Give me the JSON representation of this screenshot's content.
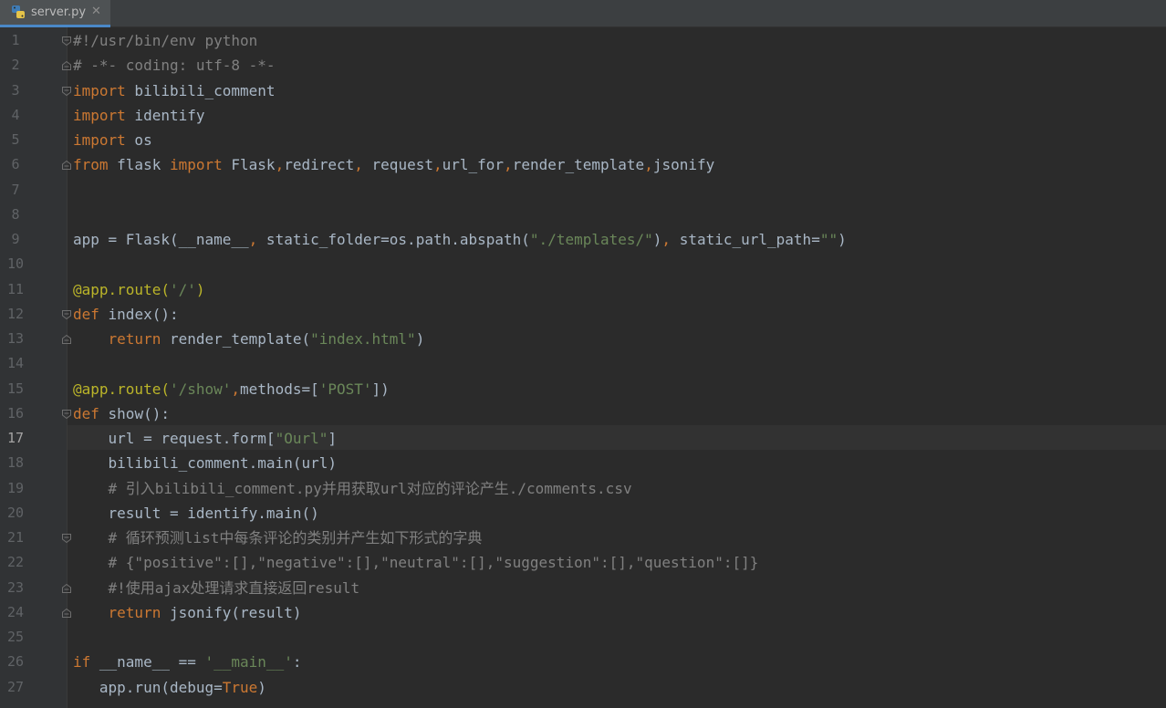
{
  "tab": {
    "filename": "server.py",
    "close_symbol": "✕"
  },
  "editor": {
    "current_line": 17,
    "line_numbers": [
      "1",
      "2",
      "3",
      "4",
      "5",
      "6",
      "7",
      "8",
      "9",
      "10",
      "11",
      "12",
      "13",
      "14",
      "15",
      "16",
      "17",
      "18",
      "19",
      "20",
      "21",
      "22",
      "23",
      "24",
      "25",
      "26",
      "27"
    ],
    "lines": [
      [
        {
          "t": "#!/usr/bin/env python",
          "c": "cmt"
        }
      ],
      [
        {
          "t": "# -*- coding: utf-8 -*-",
          "c": "cmt"
        }
      ],
      [
        {
          "t": "import",
          "c": "kw"
        },
        {
          "t": " bilibili_comment",
          "c": "cn"
        }
      ],
      [
        {
          "t": "import",
          "c": "kw"
        },
        {
          "t": " identify",
          "c": "cn"
        }
      ],
      [
        {
          "t": "import",
          "c": "kw"
        },
        {
          "t": " os",
          "c": "cn"
        }
      ],
      [
        {
          "t": "from",
          "c": "kw"
        },
        {
          "t": " flask ",
          "c": "cn"
        },
        {
          "t": "import",
          "c": "kw"
        },
        {
          "t": " Flask",
          "c": "cn"
        },
        {
          "t": ",",
          "c": "kw"
        },
        {
          "t": "redirect",
          "c": "cn"
        },
        {
          "t": ",",
          "c": "kw"
        },
        {
          "t": " request",
          "c": "cn"
        },
        {
          "t": ",",
          "c": "kw"
        },
        {
          "t": "url_for",
          "c": "cn"
        },
        {
          "t": ",",
          "c": "kw"
        },
        {
          "t": "render_template",
          "c": "cn"
        },
        {
          "t": ",",
          "c": "kw"
        },
        {
          "t": "jsonify",
          "c": "cn"
        }
      ],
      [],
      [],
      [
        {
          "t": "app = Flask(__name__",
          "c": "cn"
        },
        {
          "t": ",",
          "c": "kw"
        },
        {
          "t": " static_folder=os.path.abspath(",
          "c": "cn"
        },
        {
          "t": "\"./templates/\"",
          "c": "str"
        },
        {
          "t": ")",
          "c": "cn"
        },
        {
          "t": ",",
          "c": "kw"
        },
        {
          "t": " static_url_path=",
          "c": "cn"
        },
        {
          "t": "\"\"",
          "c": "str"
        },
        {
          "t": ")",
          "c": "cn"
        }
      ],
      [],
      [
        {
          "t": "@app.route(",
          "c": "deco"
        },
        {
          "t": "'/'",
          "c": "str"
        },
        {
          "t": ")",
          "c": "deco"
        }
      ],
      [
        {
          "t": "def",
          "c": "kw"
        },
        {
          "t": " index():",
          "c": "cn"
        }
      ],
      [
        {
          "t": "    ",
          "c": "cn"
        },
        {
          "t": "return",
          "c": "kw"
        },
        {
          "t": " render_template(",
          "c": "cn"
        },
        {
          "t": "\"index.html\"",
          "c": "str"
        },
        {
          "t": ")",
          "c": "cn"
        }
      ],
      [],
      [
        {
          "t": "@app.route(",
          "c": "deco"
        },
        {
          "t": "'/show'",
          "c": "str"
        },
        {
          "t": ",",
          "c": "kw"
        },
        {
          "t": "methods=[",
          "c": "cn"
        },
        {
          "t": "'POST'",
          "c": "str"
        },
        {
          "t": "])",
          "c": "cn"
        }
      ],
      [
        {
          "t": "def",
          "c": "kw"
        },
        {
          "t": " show():",
          "c": "cn"
        }
      ],
      [
        {
          "t": "    url = request.form[",
          "c": "cn"
        },
        {
          "t": "\"Ourl\"",
          "c": "str"
        },
        {
          "t": "]",
          "c": "cn"
        }
      ],
      [
        {
          "t": "    bilibili_comment.main(url)",
          "c": "cn"
        }
      ],
      [
        {
          "t": "    # 引入bilibili_comment.py并用获取url对应的评论产生./comments.csv",
          "c": "cmt"
        }
      ],
      [
        {
          "t": "    result = identify.main()",
          "c": "cn"
        }
      ],
      [
        {
          "t": "    # 循环预测list中每条评论的类别并产生如下形式的字典",
          "c": "cmt"
        }
      ],
      [
        {
          "t": "    # {\"positive\":[],\"negative\":[],\"neutral\":[],\"suggestion\":[],\"question\":[]}",
          "c": "cmt"
        }
      ],
      [
        {
          "t": "    #!使用ajax处理请求直接返回result",
          "c": "cmt"
        }
      ],
      [
        {
          "t": "    ",
          "c": "cn"
        },
        {
          "t": "return",
          "c": "kw"
        },
        {
          "t": " jsonify(result)",
          "c": "cn"
        }
      ],
      [],
      [
        {
          "t": "if",
          "c": "kw"
        },
        {
          "t": " __name__ == ",
          "c": "cn"
        },
        {
          "t": "'__main__'",
          "c": "str"
        },
        {
          "t": ":",
          "c": "cn"
        }
      ],
      [
        {
          "t": "   app.run(debug=",
          "c": "cn"
        },
        {
          "t": "True",
          "c": "kw"
        },
        {
          "t": ")",
          "c": "cn"
        }
      ]
    ],
    "fold_markers": [
      {
        "line": 1,
        "kind": "open"
      },
      {
        "line": 2,
        "kind": "end"
      },
      {
        "line": 3,
        "kind": "open"
      },
      {
        "line": 6,
        "kind": "end"
      },
      {
        "line": 12,
        "kind": "open"
      },
      {
        "line": 13,
        "kind": "end"
      },
      {
        "line": 16,
        "kind": "open"
      },
      {
        "line": 21,
        "kind": "open"
      },
      {
        "line": 23,
        "kind": "end"
      },
      {
        "line": 24,
        "kind": "end"
      }
    ]
  }
}
